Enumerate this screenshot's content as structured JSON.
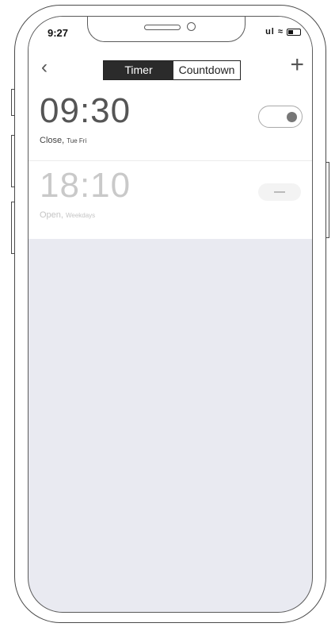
{
  "status_bar": {
    "time": "9:27",
    "icons": "ul ≈"
  },
  "nav": {
    "segments": [
      "Timer",
      "Countdown"
    ],
    "active_segment": "Timer"
  },
  "timers": [
    {
      "time": "09:30",
      "action": "Close,",
      "days": "Tue Fri",
      "enabled": true
    },
    {
      "time": "18:10",
      "action": "Open,",
      "days": "Weekdays",
      "enabled": false
    }
  ]
}
